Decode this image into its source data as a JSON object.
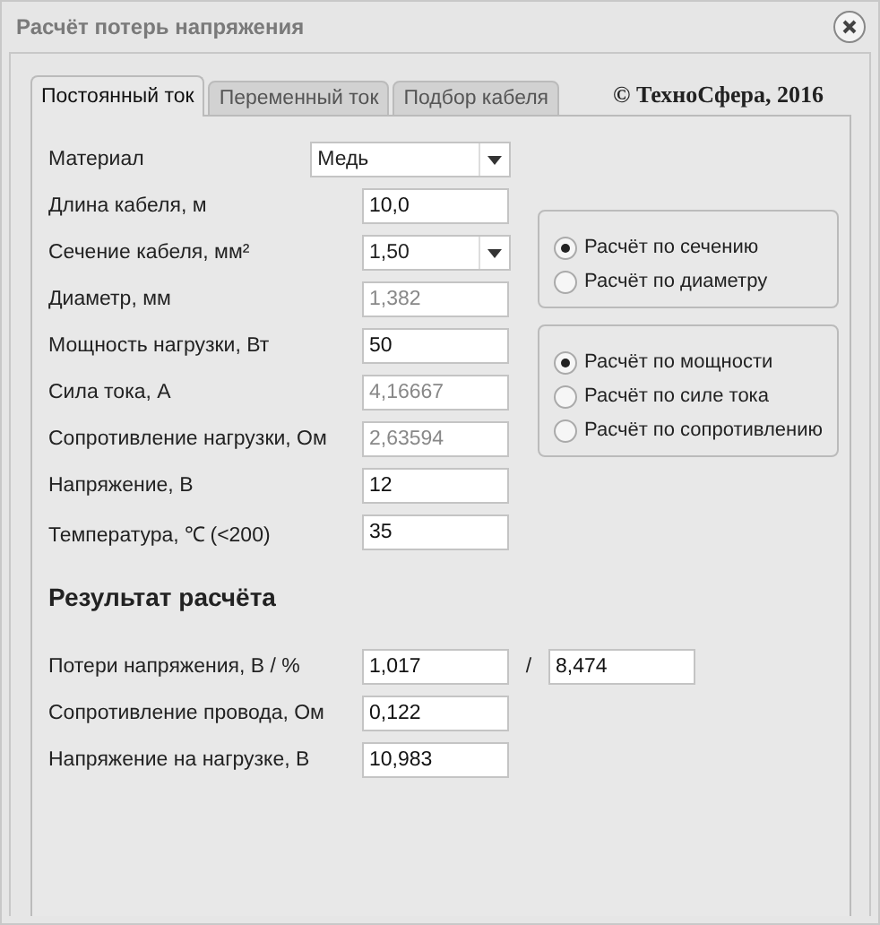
{
  "window": {
    "title": "Расчёт потерь напряжения"
  },
  "tabs": [
    {
      "label": "Постоянный ток",
      "selected": true
    },
    {
      "label": "Переменный ток",
      "selected": false
    },
    {
      "label": "Подбор кабеля",
      "selected": false
    }
  ],
  "copyright": "© ТехноСфера, 2016",
  "fields": [
    {
      "label": "Материал",
      "kind": "select",
      "value": "Медь"
    },
    {
      "label": "Длина кабеля, м",
      "kind": "input",
      "value": "10,0",
      "disabled": false
    },
    {
      "label": "Сечение кабеля, мм²",
      "kind": "combo",
      "value": "1,50"
    },
    {
      "label": "Диаметр, мм",
      "kind": "input",
      "value": "1,382",
      "disabled": true
    },
    {
      "label": "Мощность нагрузки, Вт",
      "kind": "input",
      "value": "50",
      "disabled": false
    },
    {
      "label": "Сила тока, А",
      "kind": "input",
      "value": "4,16667",
      "disabled": true
    },
    {
      "label": "Сопротивление нагрузки, Ом",
      "kind": "input",
      "value": "2,63594",
      "disabled": true
    },
    {
      "label": "Напряжение, В",
      "kind": "input",
      "value": "12",
      "disabled": false
    },
    {
      "label": "Температура, ℃ (<200)",
      "kind": "input",
      "value": "35",
      "disabled": false
    }
  ],
  "radio_groups": [
    {
      "options": [
        {
          "label": "Расчёт по сечению",
          "selected": true
        },
        {
          "label": "Расчёт по диаметру",
          "selected": false
        }
      ]
    },
    {
      "options": [
        {
          "label": "Расчёт по мощности",
          "selected": true
        },
        {
          "label": "Расчёт по силе тока",
          "selected": false
        },
        {
          "label": "Расчёт по сопротивлению",
          "selected": false
        }
      ]
    }
  ],
  "results": {
    "heading": "Результат расчёта",
    "rows": [
      {
        "label": "Потери напряжения, В / %",
        "values": [
          "1,017",
          "8,474"
        ],
        "separator": "/"
      },
      {
        "label": "Сопротивление провода, Ом",
        "values": [
          "0,122"
        ]
      },
      {
        "label": "Напряжение на нагрузке, В",
        "values": [
          "10,983"
        ]
      }
    ]
  }
}
